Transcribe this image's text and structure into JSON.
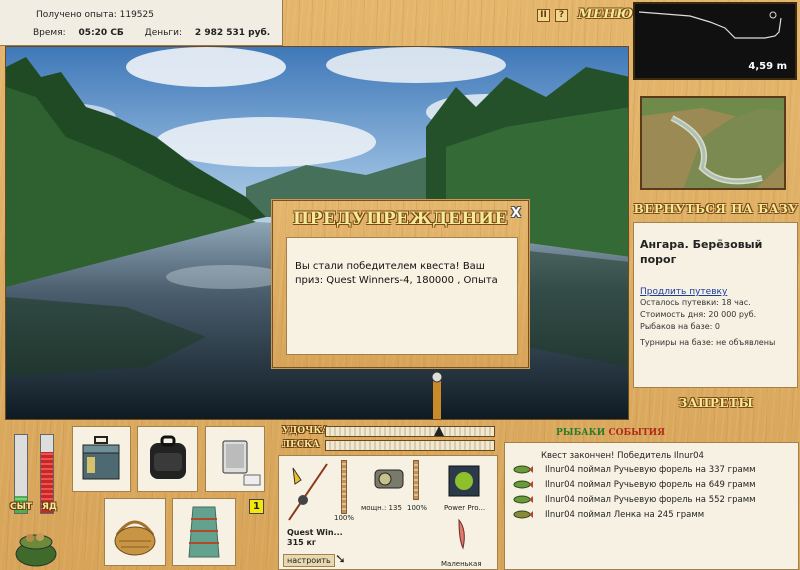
{
  "stats": {
    "exp_label": "Получено опыта:",
    "exp_value": "119525",
    "time_label": "Время:",
    "time_value": "05:20 СБ",
    "money_label": "Деньги:",
    "money_value": "2 982 531 руб."
  },
  "top_buttons": {
    "pause": "II",
    "help": "?",
    "menu": "МЕНЮ"
  },
  "modal": {
    "title": "ПРЕДУПРЕЖДЕНИЕ",
    "close": "X",
    "text": "Вы стали победителем квеста! Ваш приз: Quest Winners-4, 180000 , Опыта"
  },
  "depth": {
    "value": "4,59 m"
  },
  "base": {
    "return_label": "ВЕРНУТЬСЯ НА БАЗУ",
    "location": "Ангара. Берёзовый порог",
    "extend_link": "Продлить путевку",
    "remaining": "Осталось путевки: 18 час.",
    "day_cost": "Стоимость дня: 20 000 руб.",
    "fishers": "Рыбаков на базе: 0",
    "tournaments": "Турниры на базе: не объявлены",
    "bans_label": "ЗАПРЕТЫ"
  },
  "gauges": {
    "satiety_label": "СЫТ",
    "poison_label": "ЯД"
  },
  "inventory": {
    "badge": "1"
  },
  "tackle": {
    "rod_label": "УДОЧКА",
    "line_label": "ЛЕСКА",
    "rod_name": "Quest Win...",
    "rod_weight": "315 кг",
    "rod_percent": "100%",
    "reel_power": "мощн.: 135",
    "reel_percent": "100%",
    "line_name": "Power Pro...",
    "lure_name": "Маленькая",
    "setup_button": "настроить"
  },
  "events": {
    "title_a": "РЫБАКИ",
    "title_b": "СОБЫТИЯ",
    "items": [
      "Квест закончен! Победитель Ilnur04",
      "Ilnur04 поймал Ручьевую форель на 337 грамм",
      "Ilnur04 поймал Ручьевую форель на 649 грамм",
      "Ilnur04 поймал Ручьевую форель на 552 грамм",
      "Ilnur04 поймал Ленка на 245 грамм"
    ]
  },
  "colors": {
    "accent": "#f5ea9a",
    "wood": "#d9a95e",
    "panel": "#f6f1e2",
    "link": "#1c3c9c"
  }
}
